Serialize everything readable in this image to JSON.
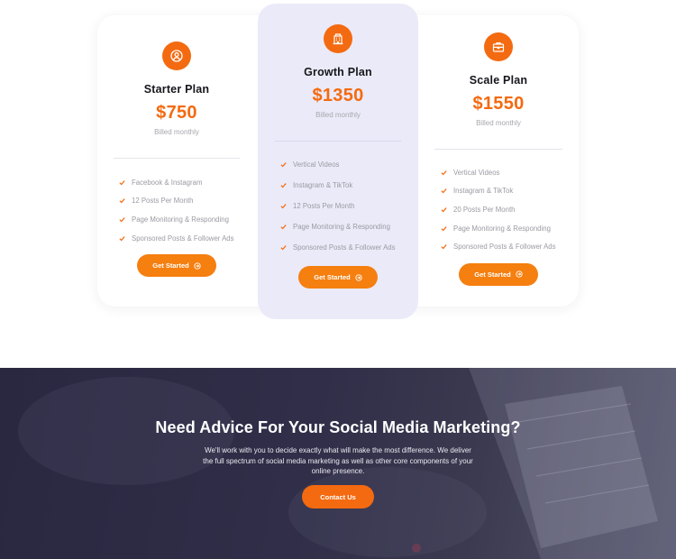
{
  "colors": {
    "accent": "#f46a10",
    "button": "#f57f0f",
    "featured_card_bg": "#ebeaf8",
    "banner_bg": "#2a2840"
  },
  "plans": [
    {
      "icon": "user-circle-icon",
      "name": "Starter Plan",
      "price": "$750",
      "billing": "Billed monthly",
      "features": [
        "Facebook & Instagram",
        "12 Posts Per Month",
        "Page Monitoring & Responding",
        "Sponsored Posts & Follower Ads"
      ],
      "cta": "Get Started"
    },
    {
      "icon": "building-icon",
      "name": "Growth Plan",
      "price": "$1350",
      "billing": "Billed monthly",
      "features": [
        "Vertical Videos",
        "Instagram & TikTok",
        "12 Posts Per Month",
        "Page Monitoring & Responding",
        "Sponsored Posts & Follower Ads"
      ],
      "cta": "Get Started"
    },
    {
      "icon": "briefcase-icon",
      "name": "Scale Plan",
      "price": "$1550",
      "billing": "Billed monthly",
      "features": [
        "Vertical Videos",
        "Instagram & TikTok",
        "20 Posts Per Month",
        "Page Monitoring & Responding",
        "Sponsored Posts & Follower Ads"
      ],
      "cta": "Get Started"
    }
  ],
  "banner": {
    "title": "Need Advice For Your Social Media Marketing?",
    "text": "We'll work with you to decide exactly what will make the most difference. We deliver the full spectrum of social media marketing as well as other core components of your online presence.",
    "button": "Contact Us"
  }
}
